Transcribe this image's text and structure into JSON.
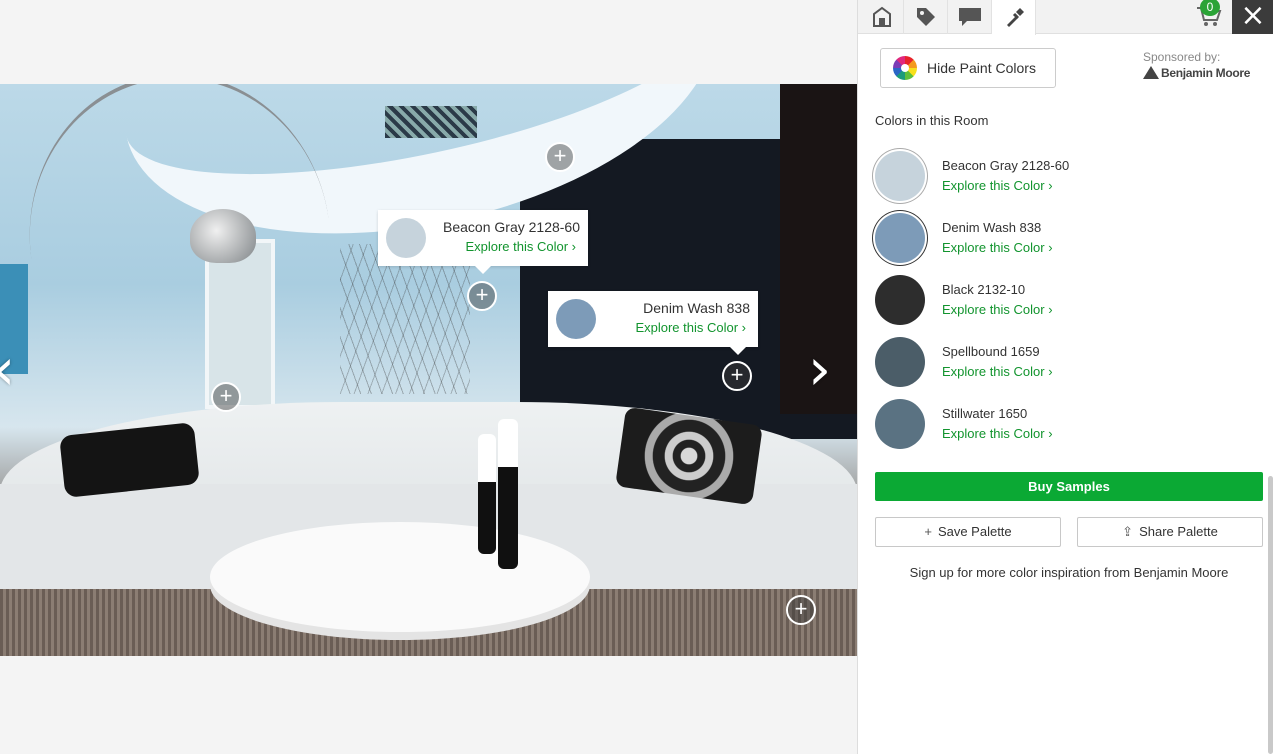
{
  "tooltips": [
    {
      "name": "Beacon Gray 2128-60",
      "explore": "Explore this Color ›",
      "color": "#c6d3dc"
    },
    {
      "name": "Denim Wash 838",
      "explore": "Explore this Color ›",
      "color": "#7d9bb8"
    }
  ],
  "panel": {
    "cart_count": "0",
    "hide_button": "Hide Paint Colors",
    "sponsor_label": "Sponsored by:",
    "sponsor_brand": "Benjamin Moore",
    "colors_heading": "Colors in this Room",
    "colors": [
      {
        "name": "Beacon Gray 2128-60",
        "explore": "Explore this Color ›",
        "hex": "#c6d3dc"
      },
      {
        "name": "Denim Wash 838",
        "explore": "Explore this Color ›",
        "hex": "#7d9bb8"
      },
      {
        "name": "Black 2132-10",
        "explore": "Explore this Color ›",
        "hex": "#2d2d2d"
      },
      {
        "name": "Spellbound 1659",
        "explore": "Explore this Color ›",
        "hex": "#4b5d68"
      },
      {
        "name": "Stillwater 1650",
        "explore": "Explore this Color ›",
        "hex": "#5a7282"
      }
    ],
    "buy_button": "Buy Samples",
    "save_button": "Save Palette",
    "share_button": "Share Palette",
    "signup_text": "Sign up for more color inspiration from Benjamin Moore"
  },
  "colors": {
    "accent_green": "#0ba934",
    "link_green": "#12942e",
    "close_bg": "#3b3b3b"
  }
}
